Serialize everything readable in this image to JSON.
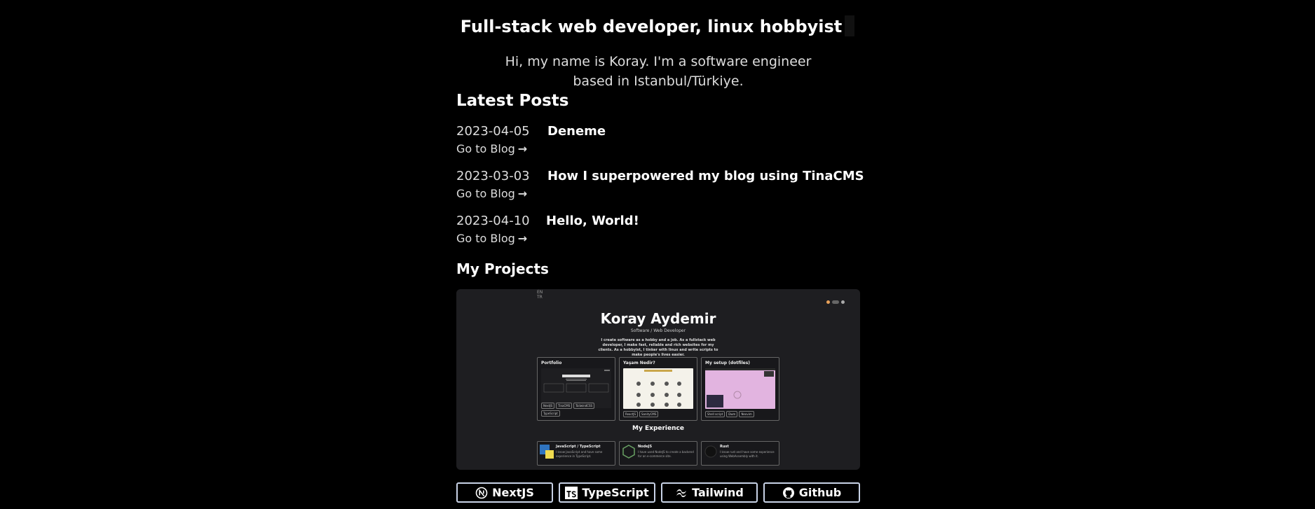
{
  "headline": "Full-stack web developer, linux hobbyist",
  "intro": "Hi, my name is Koray. I'm a software engineer based in Istanbul/Türkiye.",
  "latest_posts": {
    "heading": "Latest Posts",
    "link_label": "Go to Blog",
    "posts": [
      {
        "date": "2023-04-05",
        "title": "Deneme"
      },
      {
        "date": "2023-03-03",
        "title": "How I superpowered my blog using TinaCMS"
      },
      {
        "date": "2023-04-10",
        "title": "Hello, World!"
      }
    ]
  },
  "projects": {
    "heading": "My Projects",
    "preview": {
      "lang_en": "EN",
      "lang_tr": "TR",
      "name": "Koray Aydemir",
      "role": "Software / Web Developer",
      "description": "I create software as a hobby and a job. As a fullstack web developer, I make fast, reliable and rich websites for my clients. As a hobbyist, I tinker with linux and write scripts to make people's lives easier.",
      "cards": [
        {
          "title": "Portfolio",
          "tags": [
            "NextJS",
            "TinaCMS",
            "TailwindCSS",
            "TypeScript"
          ]
        },
        {
          "title": "Yaşam Nedir?",
          "tags": [
            "ReactJS",
            "SanityCMS"
          ]
        },
        {
          "title": "My setup (dotfiles)",
          "tags": [
            "Shell script",
            "Dwm",
            "Neovim"
          ]
        }
      ],
      "experience_heading": "My Experience",
      "skills": [
        {
          "name": "JavaScript / TypeScript",
          "desc": "I know JavaScript and have some experience in TypeScript."
        },
        {
          "name": "NodeJS",
          "desc": "I have used NodeJS to create a backend for an e-commerce site."
        },
        {
          "name": "Rust",
          "desc": "I know rust and have some experience using WebAssembly with it."
        }
      ]
    }
  },
  "tech_buttons": [
    {
      "label": "NextJS",
      "icon": "nextjs-icon"
    },
    {
      "label": "TypeScript",
      "icon": "typescript-icon"
    },
    {
      "label": "Tailwind",
      "icon": "tailwind-icon"
    },
    {
      "label": "Github",
      "icon": "github-icon"
    }
  ],
  "colors": {
    "background": "#000000",
    "button_border": "#c8d2e6",
    "preview_bg": "#1e1e21"
  }
}
